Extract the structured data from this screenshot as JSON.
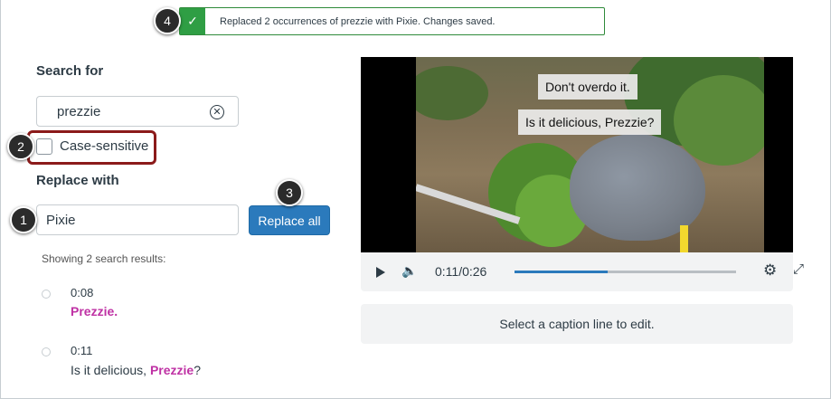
{
  "toast": {
    "message": "Replaced 2 occurrences of prezzie with Pixie. Changes saved.",
    "icon": "check-icon",
    "color": "#2f9e44"
  },
  "callouts": [
    "1",
    "2",
    "3",
    "4"
  ],
  "search": {
    "label": "Search for",
    "value": "prezzie",
    "clear_icon": "clear-circle-icon"
  },
  "case_sensitive": {
    "label": "Case-sensitive",
    "checked": false
  },
  "replace": {
    "label": "Replace with",
    "value": "Pixie",
    "button_label": "Replace all",
    "button_color": "#2b7abc"
  },
  "results": {
    "summary": "Showing 2 search results:",
    "items": [
      {
        "time": "0:08",
        "before": "",
        "match": "Prezzie",
        "after": "."
      },
      {
        "time": "0:11",
        "before": "Is it delicious, ",
        "match": "Prezzie",
        "after": "?"
      }
    ],
    "highlight_color": "#bf32a4"
  },
  "video": {
    "captions": [
      "Don't overdo it.",
      "Is it delicious, Prezzie?"
    ],
    "time": "0:11/0:26",
    "progress": 0.42,
    "controls": [
      "play-icon",
      "volume-icon",
      "gear-icon",
      "fullscreen-icon"
    ]
  },
  "caption_panel": {
    "placeholder": "Select a caption line to edit."
  }
}
